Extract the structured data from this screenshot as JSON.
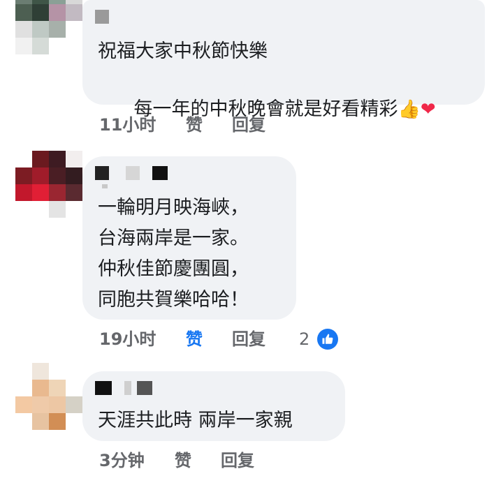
{
  "comments": [
    {
      "lines": [
        "祝福大家中秋節快樂",
        "每一年的中秋晚會就是好看精彩"
      ],
      "emojis": [
        "👍",
        "❤"
      ],
      "time": "11小时",
      "like_label": "赞",
      "reply_label": "回复"
    },
    {
      "lines": [
        "一輪明月映海峽，",
        "台海兩岸是一家。",
        "仲秋佳節慶團圓，",
        "同胞共賀樂哈哈！"
      ],
      "time": "19小时",
      "like_label": "赞",
      "reply_label": "回复",
      "reaction_count": "2",
      "liked": true
    },
    {
      "lines": [
        "天涯共此時 兩岸一家親"
      ],
      "time": "3分钟",
      "like_label": "赞",
      "reply_label": "回复"
    }
  ],
  "colors": {
    "bubble": "#f0f2f5",
    "meta_text": "#65676b",
    "like_active": "#1877f2",
    "heart": "#f02849"
  },
  "icons": [
    "thumbs-up-icon",
    "heart-icon",
    "like-badge-icon"
  ]
}
